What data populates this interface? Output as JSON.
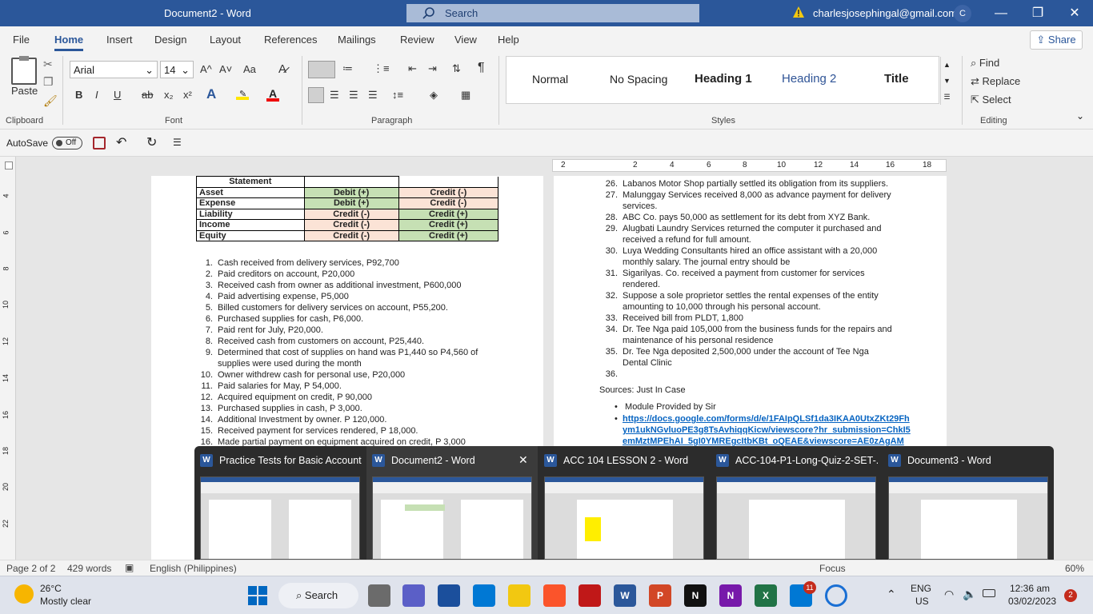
{
  "window": {
    "doc_title": "Document2 - Word",
    "search_label": "Search",
    "account": "charlesjosephingal@gmail.com",
    "avatar_initial": "C",
    "controls": [
      "—",
      "❐",
      "✕"
    ]
  },
  "menu": {
    "tabs": [
      "File",
      "Home",
      "Insert",
      "Design",
      "Layout",
      "References",
      "Mailings",
      "Review",
      "View",
      "Help"
    ],
    "active": "Home",
    "share_label": "Share"
  },
  "ribbon": {
    "clipboard": {
      "group": "Clipboard",
      "paste": "Paste"
    },
    "font": {
      "group": "Font",
      "family": "Arial",
      "size": "14",
      "bold": "B",
      "italic": "I",
      "underline": "U",
      "strike": "ab",
      "sub": "x₂",
      "sup": "x²",
      "grow": "A^",
      "shrink": "A˅",
      "case": "Aa"
    },
    "paragraph": {
      "group": "Paragraph"
    },
    "styles": {
      "group": "Styles",
      "items": [
        "Normal",
        "No Spacing",
        "Heading 1",
        "Heading 2",
        "Title"
      ]
    },
    "editing": {
      "group": "Editing",
      "find": "Find",
      "replace": "Replace",
      "select": "Select"
    }
  },
  "qat": {
    "autosave": "AutoSave",
    "toggle": "Off"
  },
  "ruler": {
    "labels": [
      "2",
      "2",
      "4",
      "6",
      "8",
      "10",
      "12",
      "14",
      "16",
      "18"
    ],
    "vlabels": [
      "4",
      "6",
      "8",
      "10",
      "12",
      "14",
      "16",
      "18",
      "20",
      "22"
    ]
  },
  "page1": {
    "table": {
      "header": "Statement",
      "rows": [
        {
          "name": "Asset",
          "debit": "Debit (+)",
          "credit": "Credit (-)",
          "dc": "g",
          "cc": "p"
        },
        {
          "name": "Expense",
          "debit": "Debit (+)",
          "credit": "Credit (-)",
          "dc": "g",
          "cc": "p"
        },
        {
          "name": "Liability",
          "debit": "Credit (-)",
          "credit": "Credit (+)",
          "dc": "p",
          "cc": "g"
        },
        {
          "name": "Income",
          "debit": "Credit (-)",
          "credit": "Credit (+)",
          "dc": "p",
          "cc": "g"
        },
        {
          "name": "Equity",
          "debit": "Credit (-)",
          "credit": "Credit (+)",
          "dc": "p",
          "cc": "g"
        }
      ]
    },
    "items": [
      {
        "n": "1.",
        "t": "Cash received from delivery services, P92,700"
      },
      {
        "n": "2.",
        "t": "Paid creditors on account, P20,000"
      },
      {
        "n": "3.",
        "t": "Received cash from owner as additional investment, P600,000"
      },
      {
        "n": "4.",
        "t": "Paid advertising expense, P5,000"
      },
      {
        "n": "5.",
        "t": "Billed customers for delivery services on account, P55,200."
      },
      {
        "n": "6.",
        "t": "Purchased supplies for cash, P6,000."
      },
      {
        "n": "7.",
        "t": "Paid rent for July, P20,000."
      },
      {
        "n": "8.",
        "t": "Received cash from customers on account, P25,440."
      },
      {
        "n": "9.",
        "t": "Determined that cost of supplies on hand was P1,440 so P4,560 of"
      },
      {
        "n": "",
        "t": "supplies were used during the month"
      },
      {
        "n": "10.",
        "t": "Owner withdrew cash for personal use, P20,000"
      },
      {
        "n": "11.",
        "t": "Paid salaries for May, P 54,000."
      },
      {
        "n": "12.",
        "t": "Acquired equipment on credit, P 90,000"
      },
      {
        "n": "13.",
        "t": "Purchased supplies in cash, P 3,000."
      },
      {
        "n": "14.",
        "t": "Additional Investment by owner. P 120,000."
      },
      {
        "n": "15.",
        "t": "Received payment for services rendered, P 18,000."
      },
      {
        "n": "16.",
        "t": "Made partial payment on equipment acquired on credit, P 3,000"
      }
    ]
  },
  "page2": {
    "items": [
      {
        "n": "26.",
        "t": "Labanos Motor Shop partially settled its obligation from its suppliers."
      },
      {
        "n": "27.",
        "t": "Malunggay Services received 8,000 as advance payment for delivery"
      },
      {
        "n": "",
        "t": "services."
      },
      {
        "n": "28.",
        "t": "ABC Co. pays 50,000 as settlement for its debt from XYZ Bank."
      },
      {
        "n": "29.",
        "t": "Alugbati Laundry Services returned the computer it purchased and"
      },
      {
        "n": "",
        "t": "received a refund for full amount."
      },
      {
        "n": "30.",
        "t": "Luya Wedding Consultants hired an office assistant with a 20,000"
      },
      {
        "n": "",
        "t": "monthly salary. The journal entry should be"
      },
      {
        "n": "31.",
        "t": "Sigarilyas. Co. received a payment from customer for services"
      },
      {
        "n": "",
        "t": "rendered."
      },
      {
        "n": "32.",
        "t": "Suppose a sole proprietor settles the rental expenses of the entity"
      },
      {
        "n": "",
        "t": "amounting to 10,000 through his personal account."
      },
      {
        "n": "33.",
        "t": "Received bill from PLDT, 1,800"
      },
      {
        "n": "34.",
        "t": "Dr. Tee Nga paid 105,000 from the business funds for the repairs and"
      },
      {
        "n": "",
        "t": "maintenance of his personal residence"
      },
      {
        "n": "35.",
        "t": "Dr. Tee Nga deposited 2,500,000 under the account of Tee Nga"
      },
      {
        "n": "",
        "t": "Dental Clinic"
      },
      {
        "n": "36.",
        "t": ""
      }
    ],
    "sources_label": "Sources: Just In Case",
    "bullets": [
      "Module Provided by Sir"
    ],
    "link_lines": [
      "https://docs.google.com/forms/d/e/1FAIpQLSf1da3IKAA0UtxZKt29Fh",
      "ym1ukNGvluoPE3g8TsAvhiqqKicw/viewscore?hr_submission=ChkI5",
      "emMztMPEhAI_5gI0YMREgcItbKBt_oQEAE&viewscore=AE0zAgAM"
    ]
  },
  "previews": [
    {
      "title": "Practice Tests for Basic Account...",
      "active": false
    },
    {
      "title": "Document2 - Word",
      "active": true
    },
    {
      "title": "ACC 104 LESSON 2 - Word",
      "active": false
    },
    {
      "title": "ACC-104-P1-Long-Quiz-2-SET-...",
      "active": false
    },
    {
      "title": "Document3 - Word",
      "active": false
    }
  ],
  "status": {
    "page": "Page 2 of 2",
    "words": "429 words",
    "language": "English (Philippines)",
    "focus": "Focus",
    "zoom": "60%"
  },
  "taskbar": {
    "temp": "26°C",
    "weather": "Mostly clear",
    "search": "Search",
    "lang1": "ENG",
    "lang2": "US",
    "time": "12:36 am",
    "date": "03/02/2023",
    "notif": "2",
    "badge": "11"
  }
}
